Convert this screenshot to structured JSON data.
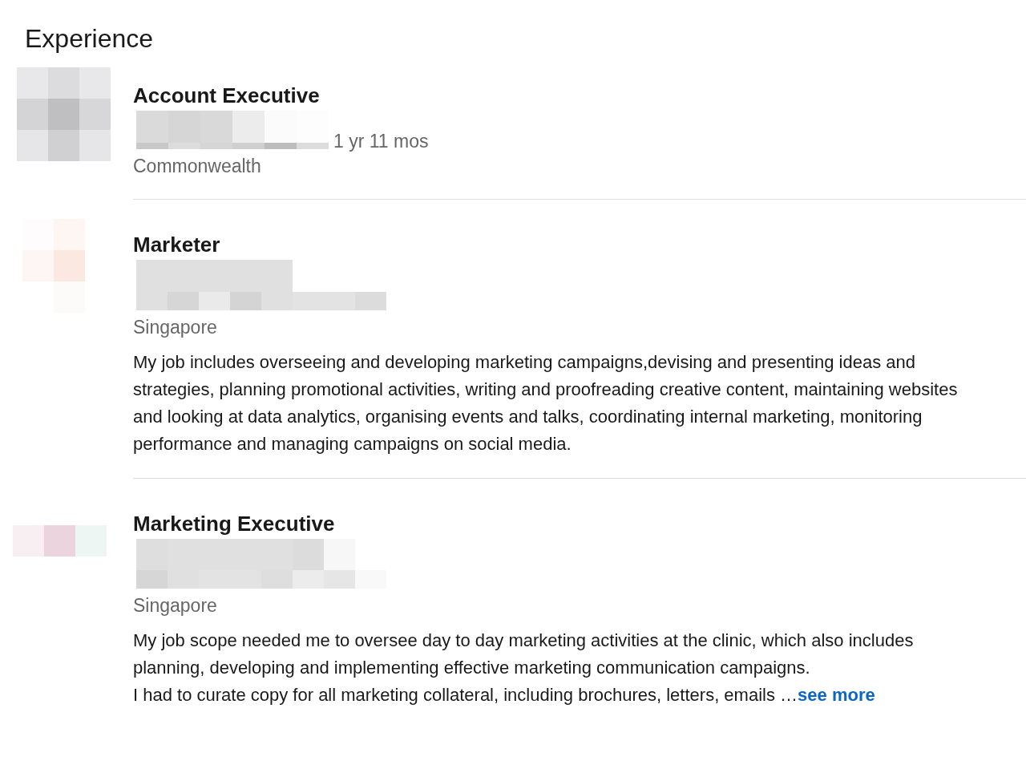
{
  "section": {
    "title": "Experience"
  },
  "positions": [
    {
      "title": "Account Executive",
      "duration": "1 yr 11 mos",
      "location": "Commonwealth"
    },
    {
      "title": "Marketer",
      "location": "Singapore",
      "description": [
        "My job includes overseeing and developing marketing campaigns,devising and presenting ideas and strategies, planning promotional activities, writing and proofreading creative content, maintaining websites and looking at data analytics, organising events and talks, coordinating internal marketing, monitoring performance and managing campaigns on social media."
      ]
    },
    {
      "title": "Marketing Executive",
      "location": "Singapore",
      "description": [
        "My job scope needed me to oversee day to day marketing activities at the clinic, which also includes planning, developing and implementing effective marketing communication campaigns.",
        "I had to curate copy for all marketing collateral, including brochures, letters, emails"
      ],
      "truncation": "…",
      "see_more": "see more"
    }
  ]
}
